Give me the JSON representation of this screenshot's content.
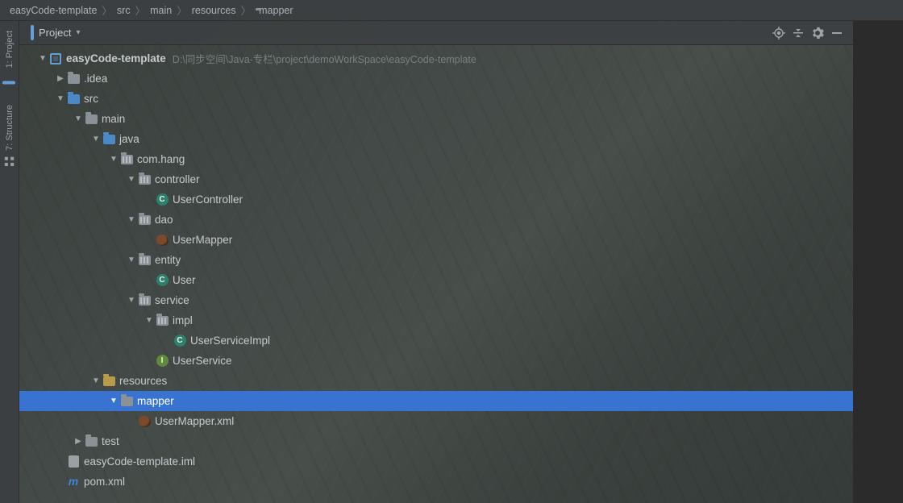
{
  "breadcrumb": {
    "items": [
      {
        "label": "easyCode-template",
        "icon": null
      },
      {
        "label": "src",
        "icon": null
      },
      {
        "label": "main",
        "icon": null
      },
      {
        "label": "resources",
        "icon": null
      },
      {
        "label": "mapper",
        "icon": "folder"
      }
    ]
  },
  "gutter": {
    "tabs": [
      {
        "id": "project",
        "label": "1: Project"
      },
      {
        "id": "structure",
        "label": "7: Structure"
      }
    ]
  },
  "toolbar": {
    "project_label": "Project"
  },
  "tree": {
    "root": {
      "label": "easyCode-template",
      "path_hint": "D:\\同步空间\\Java-专栏\\project\\demoWorkSpace\\easyCode-template",
      "expanded": true,
      "children": [
        {
          "label": ".idea",
          "icon": "folder",
          "expanded": false,
          "arrow": "right"
        },
        {
          "label": "src",
          "icon": "folder-blue",
          "expanded": true,
          "arrow": "down",
          "children": [
            {
              "label": "main",
              "icon": "folder",
              "expanded": true,
              "arrow": "down",
              "children": [
                {
                  "label": "java",
                  "icon": "folder-blue",
                  "expanded": true,
                  "arrow": "down",
                  "children": [
                    {
                      "label": "com.hang",
                      "icon": "package",
                      "expanded": true,
                      "arrow": "down",
                      "children": [
                        {
                          "label": "controller",
                          "icon": "package",
                          "expanded": true,
                          "arrow": "down",
                          "children": [
                            {
                              "label": "UserController",
                              "icon": "class"
                            }
                          ]
                        },
                        {
                          "label": "dao",
                          "icon": "package",
                          "expanded": true,
                          "arrow": "down",
                          "children": [
                            {
                              "label": "UserMapper",
                              "icon": "bean"
                            }
                          ]
                        },
                        {
                          "label": "entity",
                          "icon": "package",
                          "expanded": true,
                          "arrow": "down",
                          "children": [
                            {
                              "label": "User",
                              "icon": "class"
                            }
                          ]
                        },
                        {
                          "label": "service",
                          "icon": "package",
                          "expanded": true,
                          "arrow": "down",
                          "children": [
                            {
                              "label": "impl",
                              "icon": "package",
                              "expanded": true,
                              "arrow": "down",
                              "children": [
                                {
                                  "label": "UserServiceImpl",
                                  "icon": "class"
                                }
                              ]
                            },
                            {
                              "label": "UserService",
                              "icon": "interface"
                            }
                          ]
                        }
                      ]
                    }
                  ]
                },
                {
                  "label": "resources",
                  "icon": "folder-res",
                  "expanded": true,
                  "arrow": "down",
                  "children": [
                    {
                      "label": "mapper",
                      "icon": "folder",
                      "expanded": true,
                      "arrow": "down",
                      "selected": true,
                      "children": [
                        {
                          "label": "UserMapper.xml",
                          "icon": "bean"
                        }
                      ]
                    }
                  ]
                }
              ]
            },
            {
              "label": "test",
              "icon": "folder",
              "expanded": false,
              "arrow": "right"
            }
          ]
        },
        {
          "label": "easyCode-template.iml",
          "icon": "iml"
        },
        {
          "label": "pom.xml",
          "icon": "m"
        }
      ]
    }
  }
}
